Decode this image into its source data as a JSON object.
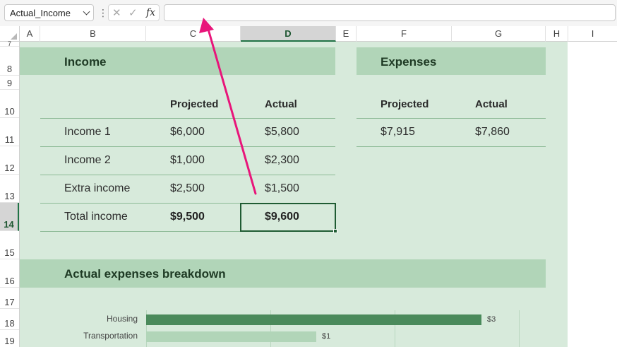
{
  "formula_bar": {
    "name_box": "Actual_Income",
    "formula": ""
  },
  "columns": [
    "A",
    "B",
    "C",
    "D",
    "E",
    "F",
    "G",
    "H",
    "I"
  ],
  "selected_column": "D",
  "rows": [
    "7",
    "8",
    "9",
    "10",
    "11",
    "12",
    "13",
    "14",
    "15",
    "16",
    "17",
    "18",
    "19"
  ],
  "selected_row": "14",
  "income": {
    "title": "Income",
    "col_projected": "Projected",
    "col_actual": "Actual",
    "items": [
      {
        "label": "Income 1",
        "projected": "$6,000",
        "actual": "$5,800"
      },
      {
        "label": "Income 2",
        "projected": "$1,000",
        "actual": "$2,300"
      },
      {
        "label": "Extra income",
        "projected": "$2,500",
        "actual": "$1,500"
      }
    ],
    "total": {
      "label": "Total income",
      "projected": "$9,500",
      "actual": "$9,600"
    }
  },
  "expenses": {
    "title": "Expenses",
    "col_projected": "Projected",
    "col_actual": "Actual",
    "projected": "$7,915",
    "actual": "$7,860"
  },
  "breakdown": {
    "title": "Actual expenses breakdown"
  },
  "chart_data": {
    "type": "bar",
    "orientation": "horizontal",
    "categories": [
      "Housing",
      "Transportation"
    ],
    "values": [
      3,
      1
    ],
    "data_labels": [
      "$3",
      "$1"
    ],
    "colors": [
      "#4a8a5b",
      "#b1d5b8"
    ]
  },
  "colors": {
    "accent": "#217346",
    "band": "#b1d5b8",
    "background": "#d7eadb",
    "arrow": "#e8157a"
  }
}
